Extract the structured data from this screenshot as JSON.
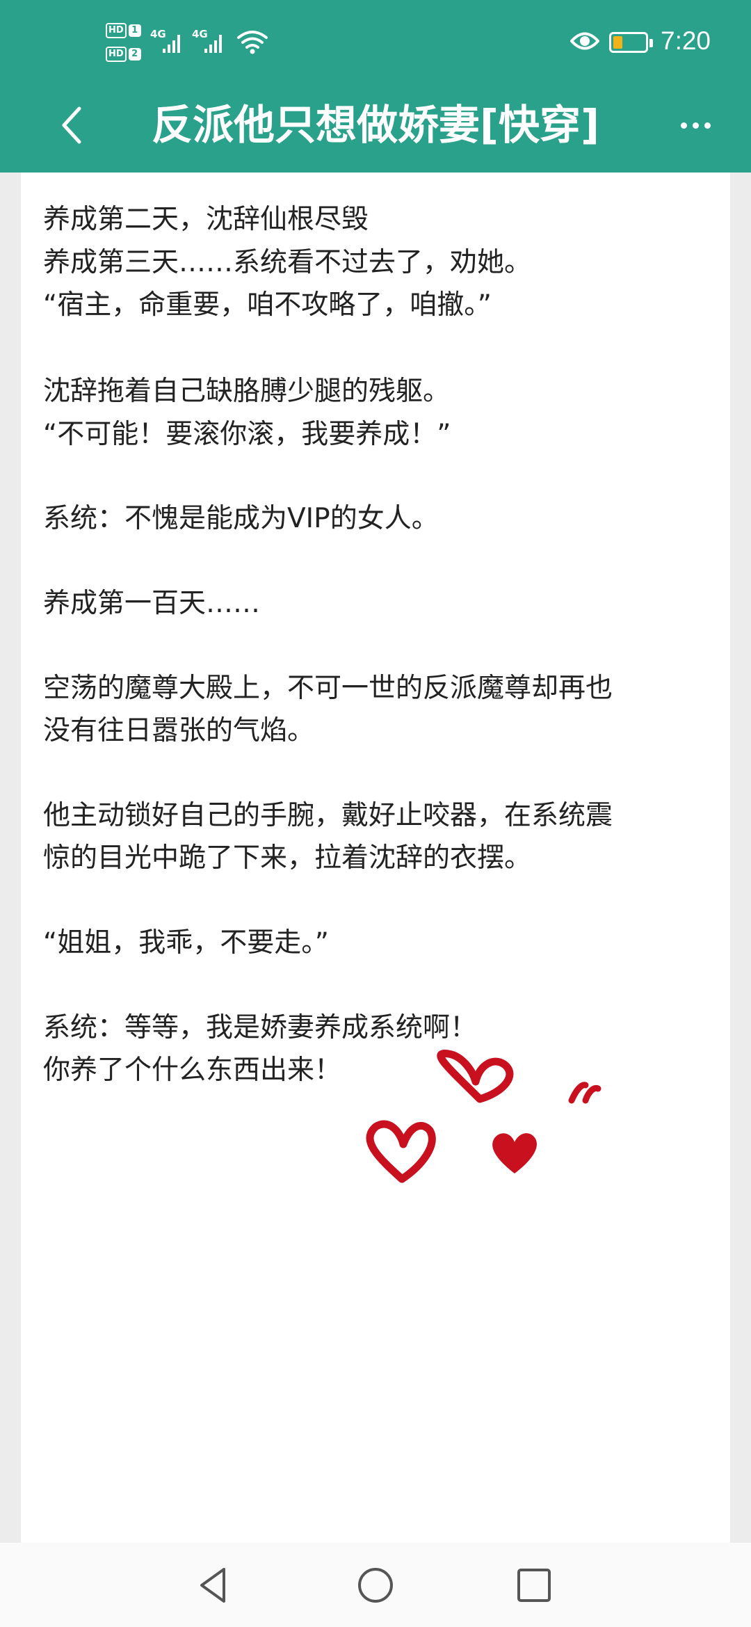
{
  "status_bar": {
    "hd1": "HD",
    "hd1_num": "1",
    "hd2": "HD",
    "hd2_num": "2",
    "net1": "4G",
    "net2": "4G",
    "battery_level": 0.3,
    "battery_color": "#f2b21a",
    "time": "7:20",
    "icons": [
      "signal-icon",
      "wifi-icon",
      "eye-icon",
      "battery-icon"
    ]
  },
  "header": {
    "title": "反派他只想做娇妻[快穿]",
    "background": "#2aa18a",
    "back_icon": "chevron-left-icon",
    "more_icon": "more-dots-icon"
  },
  "content": {
    "lines": [
      "养成第二天，沈辞仙根尽毁",
      "养成第三天……系统看不过去了，劝她。",
      "“宿主，命重要，咱不攻略了，咱撤。”",
      "沈辞拖着自己缺胳膊少腿的残躯。",
      "“不可能！要滚你滚，我要养成！”",
      "系统：不愧是能成为VIP的女人。",
      "养成第一百天……",
      "空荡的魔尊大殿上，不可一世的反派魔尊却再也",
      "没有往日嚣张的气焰。",
      "他主动锁好自己的手腕，戴好止咬器，在系统震",
      "惊的目光中跪了下来，拉着沈辞的衣摆。",
      "“姐姐，我乖，不要走。”",
      "系统：等等，我是娇妻养成系统啊！",
      "你养了个什么东西出来！"
    ],
    "decoration": "heart-stickers"
  },
  "bottom_nav": {
    "icons": [
      "back-triangle-icon",
      "home-circle-icon",
      "recents-square-icon"
    ]
  }
}
